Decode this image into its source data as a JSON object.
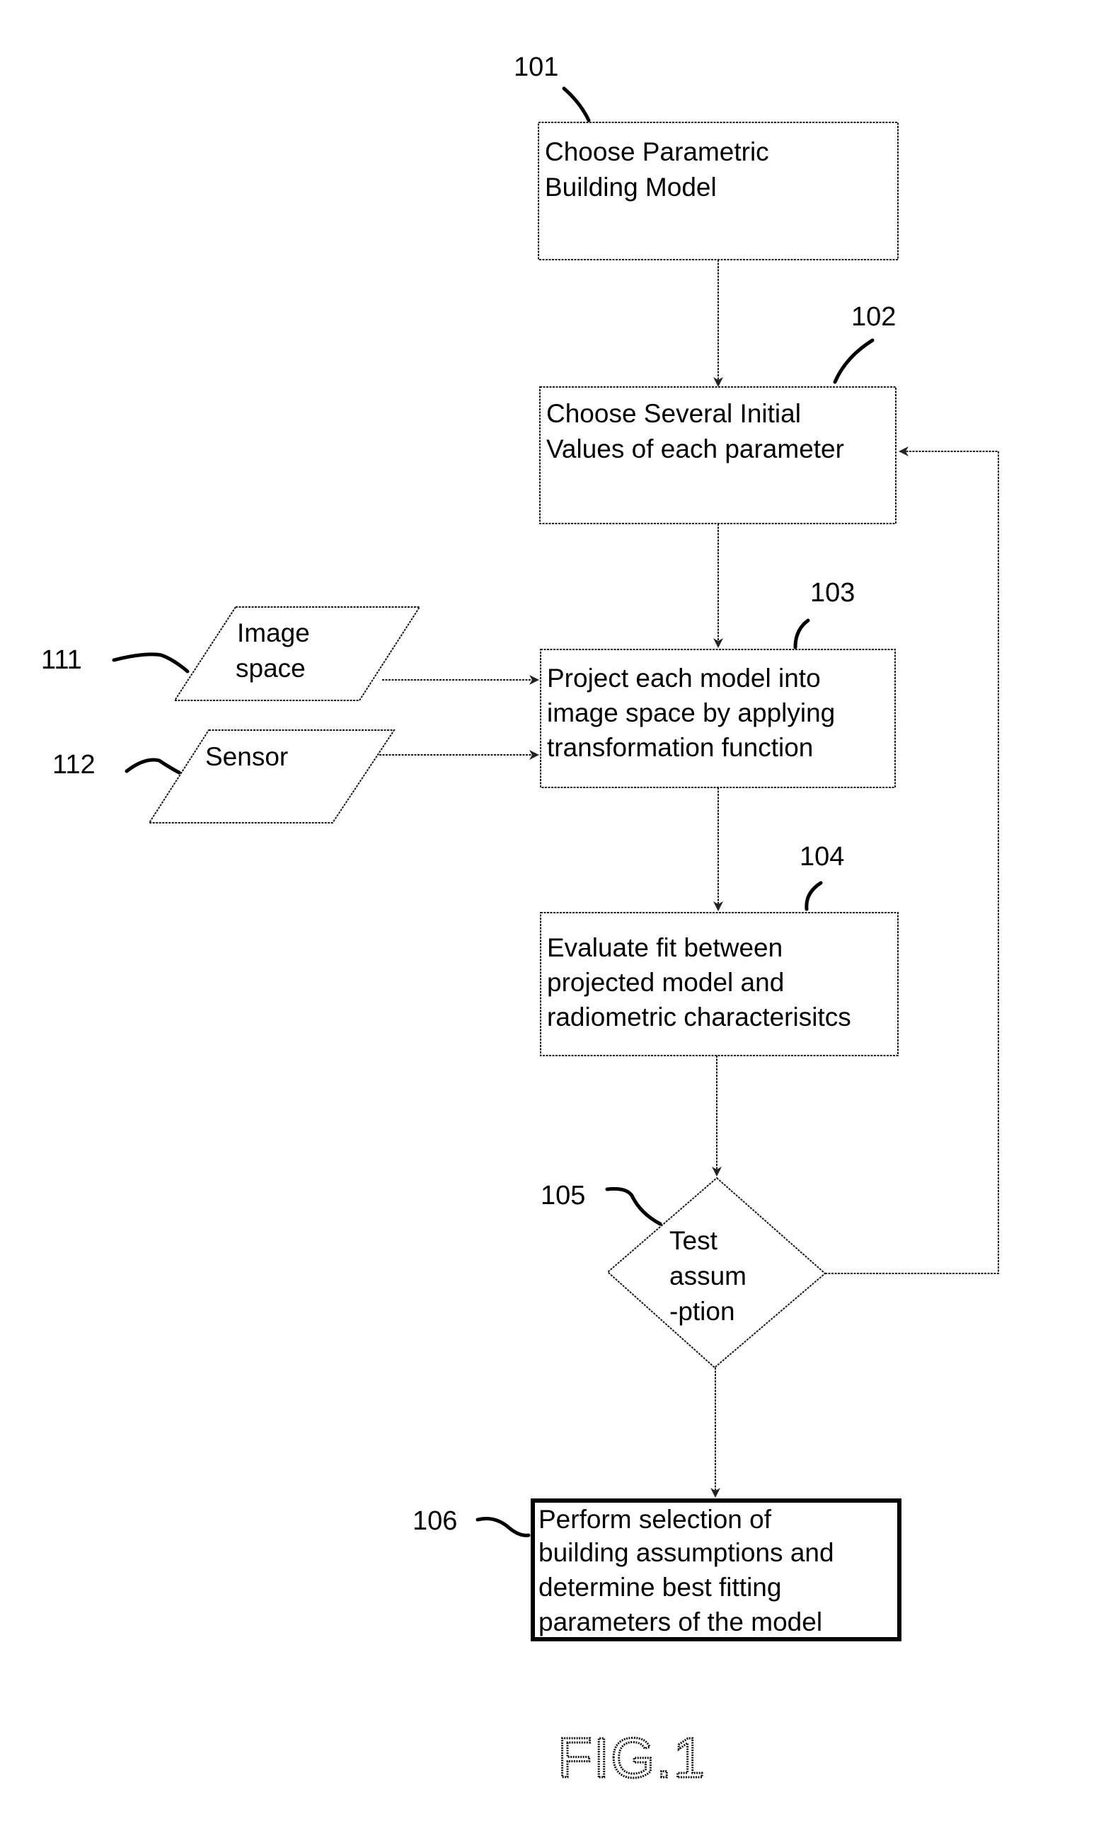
{
  "figure": {
    "caption": "FIG.1",
    "type": "flowchart"
  },
  "nodes": {
    "n101": {
      "ref": "101",
      "shape": "process",
      "lines": [
        "Choose Parametric",
        "Building Model"
      ]
    },
    "n102": {
      "ref": "102",
      "shape": "process",
      "lines": [
        "Choose Several Initial",
        "Values of each parameter"
      ]
    },
    "n103": {
      "ref": "103",
      "shape": "process",
      "lines": [
        "Project each model into",
        "image space by applying",
        "transformation function"
      ]
    },
    "n104": {
      "ref": "104",
      "shape": "process",
      "lines": [
        "Evaluate fit between",
        "projected model and",
        "radiometric characterisitcs"
      ]
    },
    "n105": {
      "ref": "105",
      "shape": "decision",
      "lines": [
        "Test",
        "assum",
        "-ption"
      ]
    },
    "n106": {
      "ref": "106",
      "shape": "terminal-process",
      "lines": [
        "Perform selection of",
        "building assumptions and",
        "determine best fitting",
        "parameters of the model"
      ]
    },
    "n111": {
      "ref": "111",
      "shape": "input-output",
      "lines": [
        "Image",
        "space"
      ]
    },
    "n112": {
      "ref": "112",
      "shape": "input-output",
      "lines": [
        "Sensor"
      ]
    }
  },
  "edges": [
    {
      "from": "101",
      "to": "102"
    },
    {
      "from": "102",
      "to": "103"
    },
    {
      "from": "111",
      "to": "103"
    },
    {
      "from": "112",
      "to": "103"
    },
    {
      "from": "103",
      "to": "104"
    },
    {
      "from": "104",
      "to": "105"
    },
    {
      "from": "105",
      "to": "102",
      "kind": "loop-back"
    },
    {
      "from": "105",
      "to": "106"
    }
  ]
}
